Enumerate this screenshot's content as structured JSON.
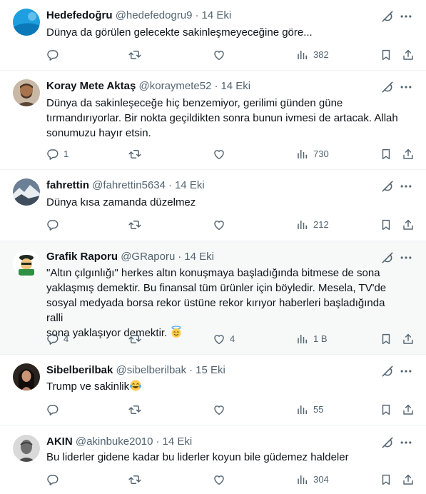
{
  "tweets": [
    {
      "name": "Hedefedoğru",
      "handle": "@hedefedogru9",
      "time": "14 Eki",
      "text": "Dünya da görülen gelecekte sakinleşmeyeceğine göre...",
      "replies": "",
      "retweets": "",
      "likes": "",
      "views": "382"
    },
    {
      "name": "Koray Mete Aktaş",
      "handle": "@koraymete52",
      "time": "14 Eki",
      "text": "Dünya da sakinleşeceğe hiç benzemiyor, gerilimi günden güne\ntırmandırıyorlar. Bir nokta geçildikten sonra bunun ivmesi de artacak. Allah\nsonumuzu hayır etsin.",
      "replies": "1",
      "retweets": "",
      "likes": "",
      "views": "730"
    },
    {
      "name": "fahrettin",
      "handle": "@fahrettin5634",
      "time": "14 Eki",
      "text": "Dünya kısa zamanda düzelmez",
      "replies": "",
      "retweets": "",
      "likes": "",
      "views": "212"
    },
    {
      "name": "Grafik Raporu",
      "handle": "@GRaporu",
      "time": "14 Eki",
      "text": "\"Altın çılgınlığı\" herkes altın konuşmaya başladığında bitmese de sona\nyaklaşmış demektir. Bu finansal tüm ürünler için böyledir. Mesela, TV'de\nsosyal medyada  borsa rekor üstüne rekor kırıyor haberleri başladığında ralli\nsona yaklaşıyor demektir.",
      "replies": "4",
      "retweets": "",
      "likes": "4",
      "views": "1 B"
    },
    {
      "name": "Sibelberilbak",
      "handle": "@sibelberilbak",
      "time": "15 Eki",
      "text": "Trump ve sakinlik",
      "replies": "",
      "retweets": "",
      "likes": "",
      "views": "55"
    },
    {
      "name": "AKIN",
      "handle": "@akinbuke2010",
      "time": "14 Eki",
      "text": "Bu liderler gidene kadar bu liderler koyun bile güdemez haldeler",
      "replies": "",
      "retweets": "",
      "likes": "",
      "views": "304"
    }
  ],
  "colors": {
    "text": "#0f1419",
    "muted": "#536471",
    "divider": "#eff3f4",
    "highlight_bg": "#f7f9f9"
  },
  "icons": [
    "grok-icon",
    "more-icon",
    "reply-icon",
    "retweet-icon",
    "like-icon",
    "views-icon",
    "bookmark-icon",
    "share-icon"
  ]
}
